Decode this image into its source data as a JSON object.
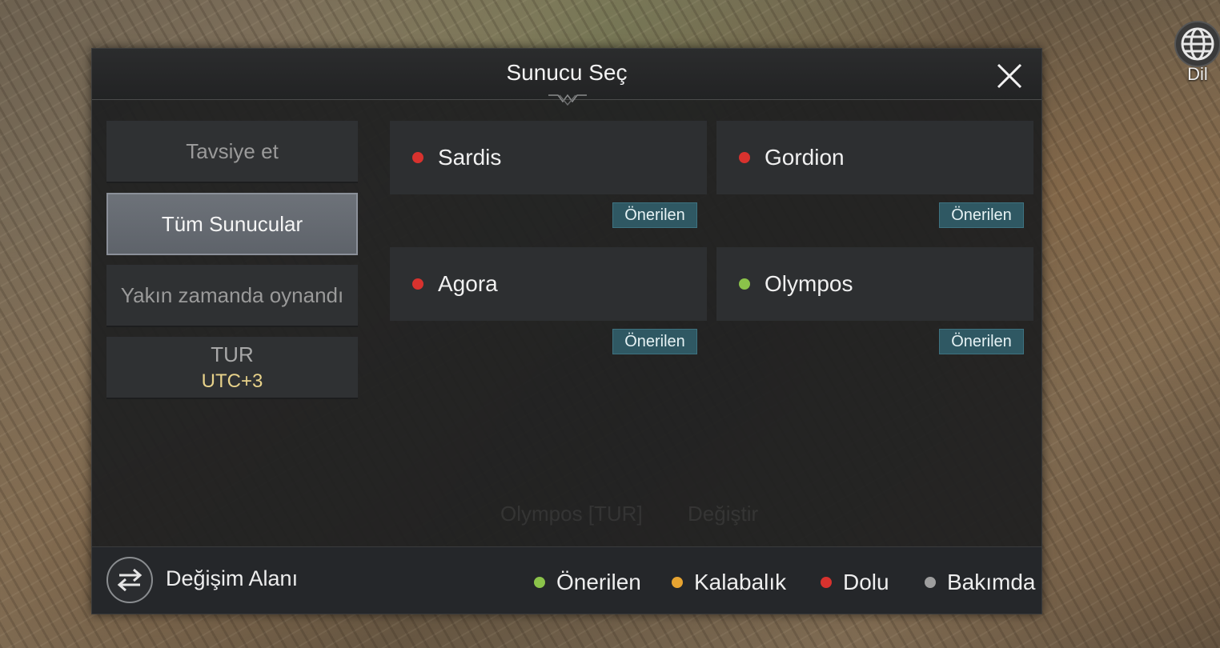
{
  "colors": {
    "recommended": "#8bc34a",
    "crowded": "#e7a431",
    "full": "#d8322e",
    "maintenance": "#9e9e9e"
  },
  "lang_button": {
    "label": "Dil",
    "icon": "globe-icon"
  },
  "dialog": {
    "title": "Sunucu Seç",
    "close_icon": "close-icon"
  },
  "nav": {
    "items": [
      {
        "label": "Tavsiye et",
        "active": false
      },
      {
        "label": "Tüm Sunucular",
        "active": true
      },
      {
        "label": "Yakın zamanda oynandı",
        "active": false
      },
      {
        "label": "TUR",
        "sub": "UTC+3",
        "active": false
      }
    ]
  },
  "servers": [
    {
      "name": "Sardis",
      "status": "full",
      "badge": "Önerilen"
    },
    {
      "name": "Gordion",
      "status": "full",
      "badge": "Önerilen"
    },
    {
      "name": "Agora",
      "status": "full",
      "badge": "Önerilen"
    },
    {
      "name": "Olympos",
      "status": "recommended",
      "badge": "Önerilen"
    }
  ],
  "background_text": {
    "server": "Olympos [TUR]",
    "action": "Değiştir"
  },
  "footer": {
    "swap_label": "Değişim Alanı",
    "swap_icon": "swap-arrows-icon",
    "legend": [
      {
        "label": "Önerilen",
        "status": "recommended"
      },
      {
        "label": "Kalabalık",
        "status": "crowded"
      },
      {
        "label": "Dolu",
        "status": "full"
      },
      {
        "label": "Bakımda",
        "status": "maintenance"
      }
    ]
  }
}
